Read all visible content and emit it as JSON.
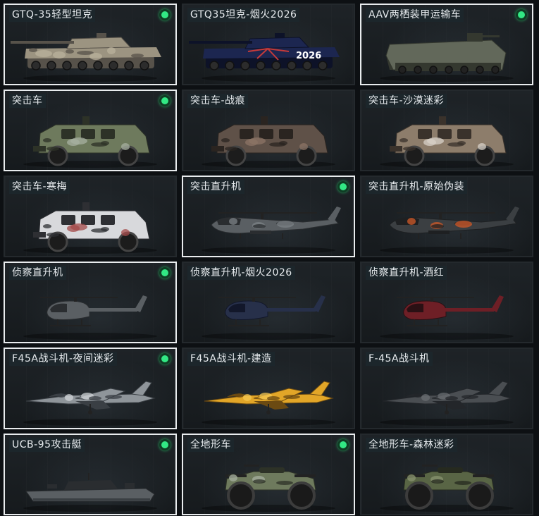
{
  "vehicles": [
    {
      "name": "GTQ-35轻型坦克",
      "kind": "tank",
      "paint": "desert",
      "owned": true
    },
    {
      "name": "GTQ35坦克-烟火2026",
      "kind": "tank",
      "paint": "fireworks",
      "decal": "2026",
      "owned": false
    },
    {
      "name": "AAV两栖装甲运输车",
      "kind": "aav",
      "paint": "olive",
      "owned": true
    },
    {
      "name": "突击车",
      "kind": "truck",
      "paint": "green",
      "owned": true
    },
    {
      "name": "突击车-战痕",
      "kind": "truck",
      "paint": "scarred",
      "owned": false
    },
    {
      "name": "突击车-沙漠迷彩",
      "kind": "truck",
      "paint": "desertcamo",
      "owned": false
    },
    {
      "name": "突击车-寒梅",
      "kind": "truck",
      "paint": "plum",
      "owned": false
    },
    {
      "name": "突击直升机",
      "kind": "heli",
      "paint": "gray",
      "owned": true
    },
    {
      "name": "突击直升机-原始伪装",
      "kind": "heli",
      "paint": "orangecamo",
      "owned": false
    },
    {
      "name": "侦察直升机",
      "kind": "scout",
      "paint": "gray",
      "owned": true
    },
    {
      "name": "侦察直升机-烟火2026",
      "kind": "scout",
      "paint": "navy",
      "owned": false
    },
    {
      "name": "侦察直升机-酒红",
      "kind": "scout",
      "paint": "wine",
      "owned": false
    },
    {
      "name": "F45A战斗机-夜间迷彩",
      "kind": "jet",
      "paint": "nightcamo",
      "owned": true
    },
    {
      "name": "F45A战斗机-建造",
      "kind": "jet",
      "paint": "yellow",
      "owned": false
    },
    {
      "name": "F-45A战斗机",
      "kind": "jet",
      "paint": "dark",
      "owned": false
    },
    {
      "name": "UCB-95攻击艇",
      "kind": "boat",
      "paint": "gray",
      "owned": true
    },
    {
      "name": "全地形车",
      "kind": "atv",
      "paint": "green",
      "owned": true
    },
    {
      "name": "全地形车-森林迷彩",
      "kind": "atv",
      "paint": "forestcamo",
      "owned": false
    }
  ]
}
